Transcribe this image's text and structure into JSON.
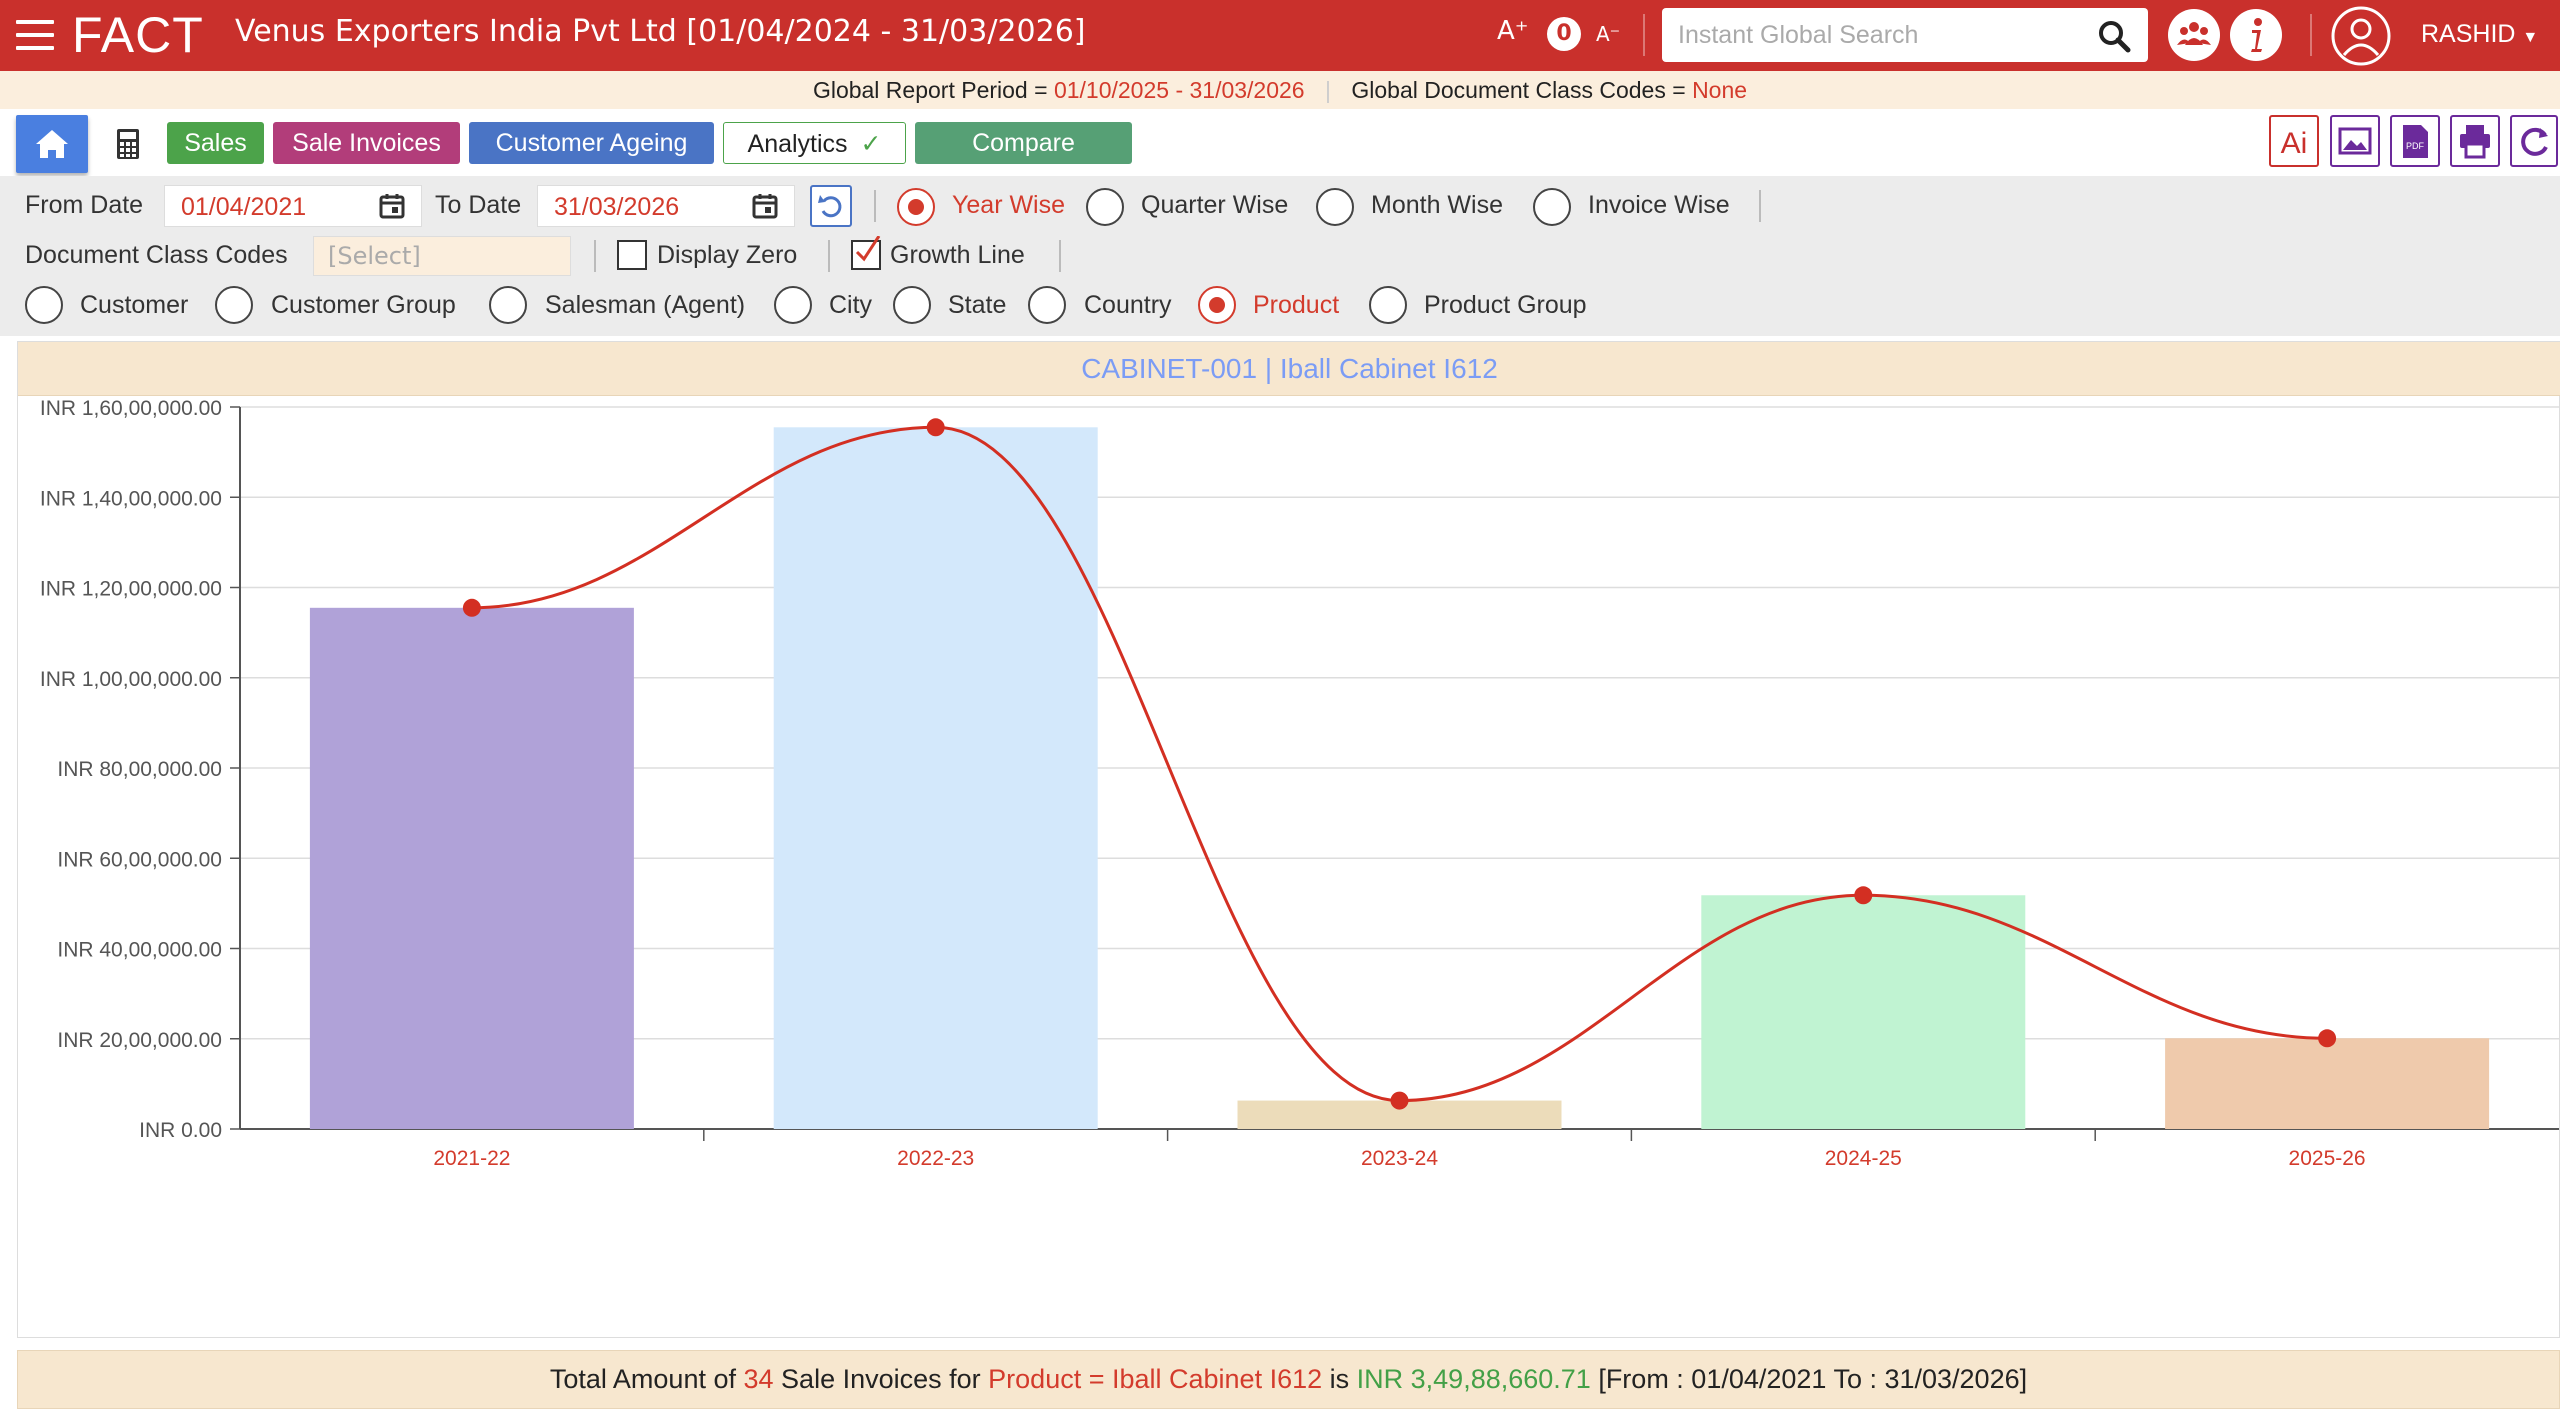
{
  "header": {
    "logo": "FACT",
    "title": "Venus Exporters India Pvt Ltd [01/04/2024 - 31/03/2026]",
    "font_increase": "A⁺",
    "font_reset": "0",
    "font_decrease": "A⁻",
    "search_placeholder": "Instant Global Search",
    "user": "RASHID"
  },
  "period_bar": {
    "period_label": "Global Report Period = ",
    "period_value": "01/10/2025 - 31/03/2026",
    "codes_label": "Global Document Class Codes = ",
    "codes_value": "None"
  },
  "toolbar": {
    "tabs": [
      {
        "label": "Sales",
        "color": "#4ca34a"
      },
      {
        "label": "Sale Invoices",
        "color": "#b23d7a"
      },
      {
        "label": "Customer Ageing",
        "color": "#4a74c5"
      },
      {
        "label": "Analytics",
        "color": "#ffffff"
      },
      {
        "label": "Compare",
        "color": "#56a075"
      }
    ]
  },
  "filters": {
    "from_label": "From Date",
    "from_value": "01/04/2021",
    "to_label": "To Date",
    "to_value": "31/03/2026",
    "period_options": [
      "Year Wise",
      "Quarter Wise",
      "Month Wise",
      "Invoice Wise"
    ],
    "period_selected": "Year Wise",
    "doc_codes_label": "Document Class Codes",
    "doc_codes_placeholder": "[Select]",
    "display_zero_label": "Display Zero",
    "display_zero_checked": false,
    "growth_line_label": "Growth Line",
    "growth_line_checked": true,
    "group_options": [
      "Customer",
      "Customer Group",
      "Salesman (Agent)",
      "City",
      "State",
      "Country",
      "Product",
      "Product Group"
    ],
    "group_selected": "Product"
  },
  "chart_data": {
    "type": "bar",
    "title": "CABINET-001 | Iball Cabinet I612",
    "categories": [
      "2021-22",
      "2022-23",
      "2023-24",
      "2024-25",
      "2025-26"
    ],
    "values": [
      11550000,
      15550000,
      630000,
      5180000,
      2010000
    ],
    "bar_colors": [
      "#b0a2d8",
      "#d3e8fb",
      "#ecdcba",
      "#c0f3d2",
      "#efcaac"
    ],
    "growth_line": true,
    "growth_line_color": "#d32f22",
    "ylim": [
      0,
      16000000
    ],
    "yticks": [
      "INR 0.00",
      "INR 20,00,000.00",
      "INR 40,00,000.00",
      "INR 60,00,000.00",
      "INR 80,00,000.00",
      "INR 1,00,00,000.00",
      "INR 1,20,00,000.00",
      "INR 1,40,00,000.00",
      "INR 1,60,00,000.00"
    ],
    "grid": true
  },
  "footer": {
    "p1": "Total Amount of ",
    "count": "34",
    "p2": " Sale Invoices for ",
    "product": "Product = Iball Cabinet I612",
    "p3": " is ",
    "amount": "INR 3,49,88,660.71",
    "p4": " [From : 01/04/2021 To : 31/03/2026]"
  }
}
